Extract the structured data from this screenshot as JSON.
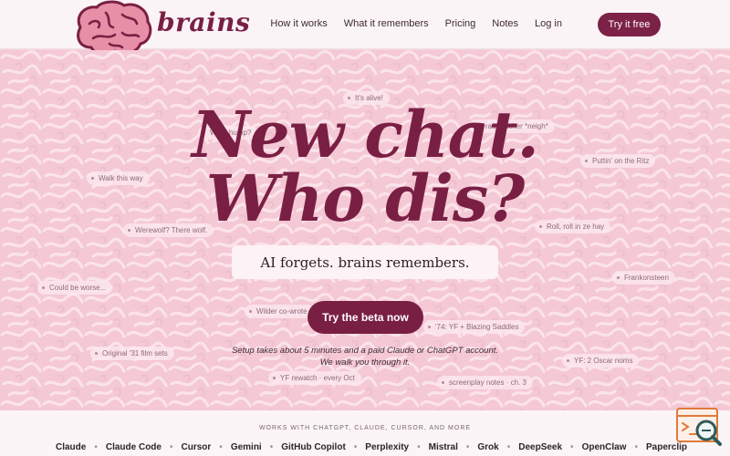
{
  "brand": {
    "name": "brains"
  },
  "nav": {
    "links": [
      "How it works",
      "What it remembers",
      "Pricing",
      "Notes",
      "Log in"
    ],
    "cta": "Try it free"
  },
  "hero": {
    "headline_line1": "New chat.",
    "headline_line2": "Who dis?",
    "tagline": "AI forgets. brains remembers.",
    "cta": "Try the beta now",
    "setup_line1": "Setup takes about 5 minutes and a paid Claude or ChatGPT account.",
    "setup_line2": "We walk you through it.",
    "floating_notes": [
      "It's alive!",
      "What hump?",
      "Frau Blücher *neigh*",
      "Puttin' on the Ritz",
      "Walk this way",
      "Werewolf? There wolf.",
      "Roll, roll in ze hay",
      "Frankonsteen",
      "Could be worse...",
      "Wilder co-wrote",
      "'74: YF + Blazing Saddles",
      "Original '31 film sets",
      "YF: 2 Oscar noms",
      "YF rewatch · every Oct",
      "screenplay notes · ch. 3"
    ]
  },
  "footer": {
    "works_with": "WORKS WITH CHATGPT, CLAUDE, CURSOR, AND MORE",
    "tools": [
      "Claude",
      "Claude Code",
      "Cursor",
      "Gemini",
      "GitHub Copilot",
      "Perplexity",
      "Mistral",
      "Grok",
      "DeepSeek",
      "OpenClaw",
      "Paperclip"
    ]
  },
  "colors": {
    "brand": "#7a1f44",
    "background": "#f6d2dc"
  }
}
